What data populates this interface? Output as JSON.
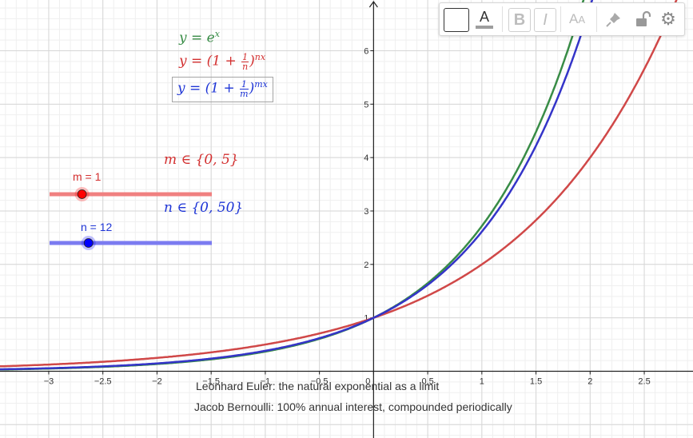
{
  "toolbar": {
    "text_tool": "A",
    "bold": "B",
    "italic": "I",
    "size_big": "A",
    "size_small": "A",
    "icons": [
      "color-swatch-icon",
      "text-style-icon",
      "bold-icon",
      "italic-icon",
      "text-size-icon",
      "pin-icon",
      "unlock-icon",
      "gear-icon"
    ]
  },
  "formulas": {
    "exp": {
      "lhs": "y = e",
      "sup": "x",
      "color": "#388c46"
    },
    "n_formula": {
      "lhs": "y = (1 + ",
      "num": "1",
      "den": "n",
      "rhs": ")",
      "sup": "nx",
      "color": "#d32f2f"
    },
    "m_formula": {
      "lhs": "y = (1 + ",
      "num": "1",
      "den": "m",
      "rhs": ")",
      "sup": "mx",
      "color": "#1e35d6"
    }
  },
  "ranges": {
    "m_range": "m ∈ {0, 5}",
    "n_range": "n ∈ {0, 50}"
  },
  "sliders": [
    {
      "name": "m",
      "label": "m = 1",
      "value": 1,
      "min": 0,
      "max": 5,
      "color": "#ff0000",
      "track_color": "#f08080"
    },
    {
      "name": "n",
      "label": "n = 12",
      "value": 12,
      "min": 0,
      "max": 50,
      "color": "#0000ff",
      "track_color": "#7b7bf0"
    }
  ],
  "captions": {
    "line1": "Leonhard Euler: the natural exponential as a limit",
    "line2": "Jacob Bernoulli: 100% annual interest, compounded periodically"
  },
  "chart_data": {
    "type": "line",
    "xlim": [
      -3.45,
      2.95
    ],
    "ylim": [
      -1.25,
      6.95
    ],
    "x_ticks": [
      -3,
      -2.5,
      -2,
      -1.5,
      -1,
      -0.5,
      0,
      0.5,
      1,
      1.5,
      2,
      2.5
    ],
    "x_tick_labels": [
      "−3",
      "−2.5",
      "−2",
      "−1.5",
      "−1",
      "−0.5",
      "0",
      "0.5",
      "1",
      "1.5",
      "2",
      "2.5"
    ],
    "y_ticks": [
      1,
      2,
      3,
      4,
      5,
      6
    ],
    "y_tick_labels": [
      "1",
      "2",
      "3",
      "4",
      "5",
      "6"
    ],
    "grid": true,
    "series": [
      {
        "name": "y = e^x",
        "base": 2.718281828,
        "color": "#388c46"
      },
      {
        "name": "y = (1 + 1/m)^(mx)",
        "base": 2,
        "color": "#d04848"
      },
      {
        "name": "y = (1 + 1/n)^(nx)",
        "base": 2.61303529,
        "color": "#3434c8"
      }
    ]
  }
}
